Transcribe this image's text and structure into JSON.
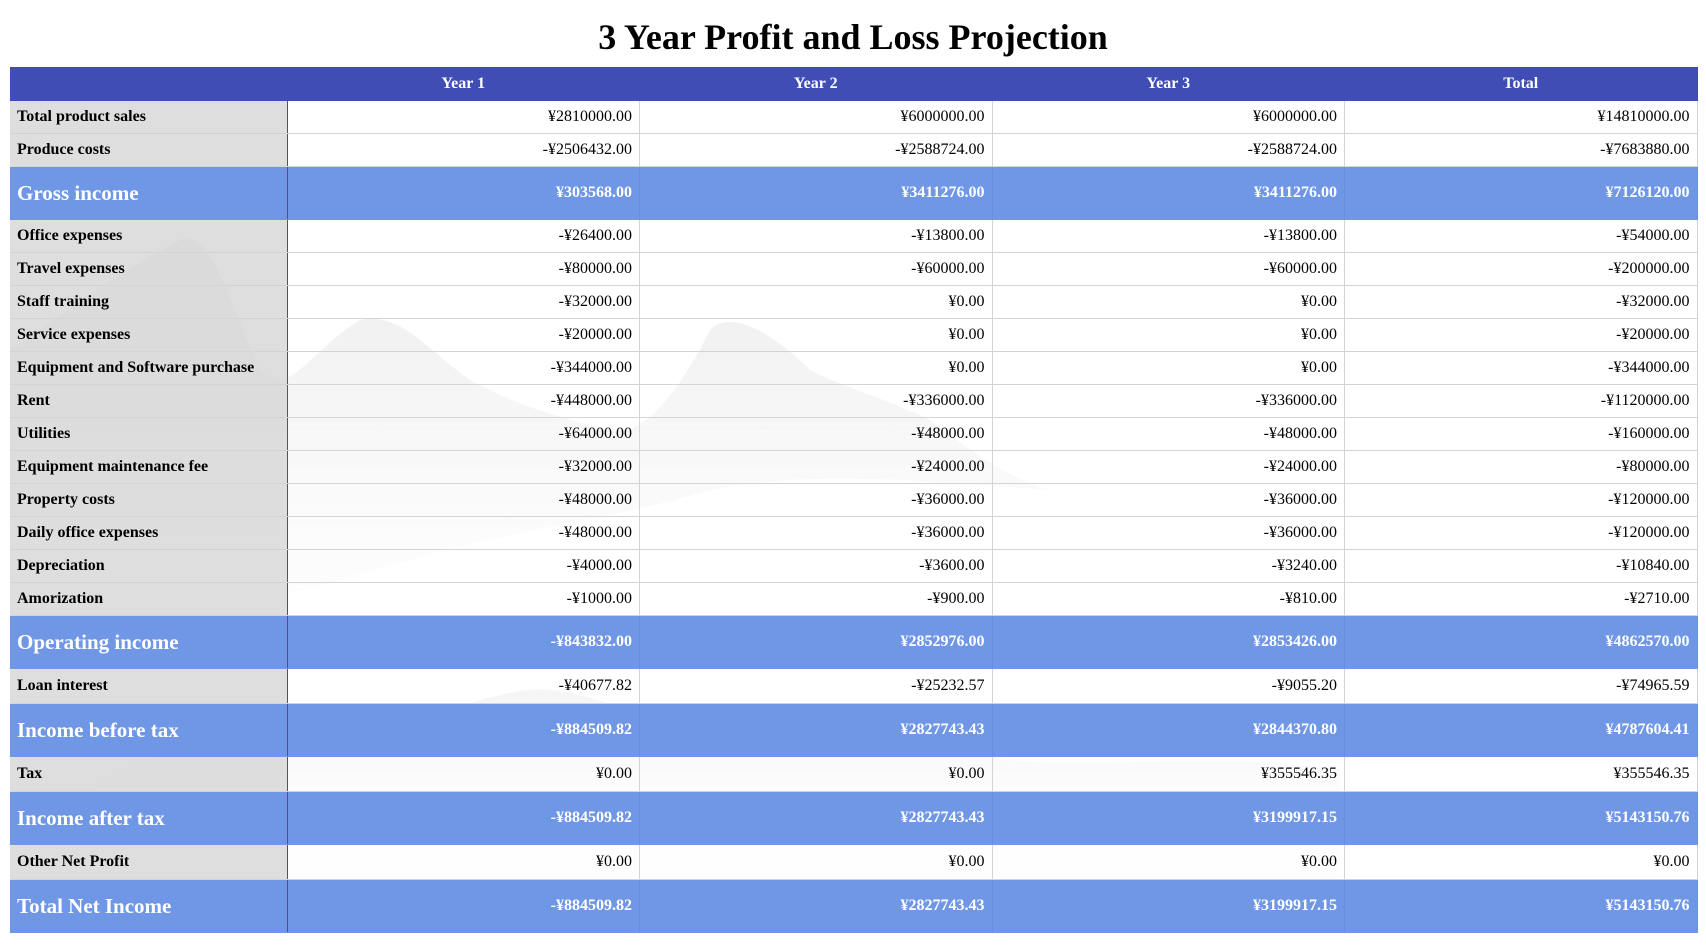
{
  "title": "3 Year Profit and Loss Projection",
  "columns": [
    "",
    "Year 1",
    "Year 2",
    "Year 3",
    "Total"
  ],
  "rows": [
    {
      "label": "Total product sales",
      "highlight": false,
      "values": [
        "¥2810000.00",
        "¥6000000.00",
        "¥6000000.00",
        "¥14810000.00"
      ]
    },
    {
      "label": "Produce costs",
      "highlight": false,
      "values": [
        "-¥2506432.00",
        "-¥2588724.00",
        "-¥2588724.00",
        "-¥7683880.00"
      ]
    },
    {
      "label": "Gross income",
      "highlight": true,
      "values": [
        "¥303568.00",
        "¥3411276.00",
        "¥3411276.00",
        "¥7126120.00"
      ]
    },
    {
      "label": "Office expenses",
      "highlight": false,
      "values": [
        "-¥26400.00",
        "-¥13800.00",
        "-¥13800.00",
        "-¥54000.00"
      ]
    },
    {
      "label": "Travel expenses",
      "highlight": false,
      "values": [
        "-¥80000.00",
        "-¥60000.00",
        "-¥60000.00",
        "-¥200000.00"
      ]
    },
    {
      "label": "Staff training",
      "highlight": false,
      "values": [
        "-¥32000.00",
        "¥0.00",
        "¥0.00",
        "-¥32000.00"
      ]
    },
    {
      "label": "Service expenses",
      "highlight": false,
      "values": [
        "-¥20000.00",
        "¥0.00",
        "¥0.00",
        "-¥20000.00"
      ]
    },
    {
      "label": "Equipment and Software purchase",
      "highlight": false,
      "values": [
        "-¥344000.00",
        "¥0.00",
        "¥0.00",
        "-¥344000.00"
      ]
    },
    {
      "label": "Rent",
      "highlight": false,
      "values": [
        "-¥448000.00",
        "-¥336000.00",
        "-¥336000.00",
        "-¥1120000.00"
      ]
    },
    {
      "label": "Utilities",
      "highlight": false,
      "values": [
        "-¥64000.00",
        "-¥48000.00",
        "-¥48000.00",
        "-¥160000.00"
      ]
    },
    {
      "label": "Equipment maintenance fee",
      "highlight": false,
      "values": [
        "-¥32000.00",
        "-¥24000.00",
        "-¥24000.00",
        "-¥80000.00"
      ]
    },
    {
      "label": "Property costs",
      "highlight": false,
      "values": [
        "-¥48000.00",
        "-¥36000.00",
        "-¥36000.00",
        "-¥120000.00"
      ]
    },
    {
      "label": "Daily office expenses",
      "highlight": false,
      "values": [
        "-¥48000.00",
        "-¥36000.00",
        "-¥36000.00",
        "-¥120000.00"
      ]
    },
    {
      "label": "Depreciation",
      "highlight": false,
      "values": [
        "-¥4000.00",
        "-¥3600.00",
        "-¥3240.00",
        "-¥10840.00"
      ]
    },
    {
      "label": "Amorization",
      "highlight": false,
      "values": [
        "-¥1000.00",
        "-¥900.00",
        "-¥810.00",
        "-¥2710.00"
      ]
    },
    {
      "label": "Operating income",
      "highlight": true,
      "values": [
        "-¥843832.00",
        "¥2852976.00",
        "¥2853426.00",
        "¥4862570.00"
      ]
    },
    {
      "label": "Loan interest",
      "highlight": false,
      "tall": true,
      "values": [
        "-¥40677.82",
        "-¥25232.57",
        "-¥9055.20",
        "-¥74965.59"
      ]
    },
    {
      "label": "Income before tax",
      "highlight": true,
      "values": [
        "-¥884509.82",
        "¥2827743.43",
        "¥2844370.80",
        "¥4787604.41"
      ]
    },
    {
      "label": "Tax",
      "highlight": false,
      "tall": true,
      "values": [
        "¥0.00",
        "¥0.00",
        "¥355546.35",
        "¥355546.35"
      ]
    },
    {
      "label": "Income after tax",
      "highlight": true,
      "values": [
        "-¥884509.82",
        "¥2827743.43",
        "¥3199917.15",
        "¥5143150.76"
      ]
    },
    {
      "label": "Other Net Profit",
      "highlight": false,
      "tall": true,
      "values": [
        "¥0.00",
        "¥0.00",
        "¥0.00",
        "¥0.00"
      ]
    },
    {
      "label": "Total Net Income",
      "highlight": true,
      "values": [
        "-¥884509.82",
        "¥2827743.43",
        "¥3199917.15",
        "¥5143150.76"
      ]
    }
  ],
  "colors": {
    "header": "#3f4db5",
    "highlight": "#7097e6",
    "label_bg": "#d8d8d8"
  }
}
